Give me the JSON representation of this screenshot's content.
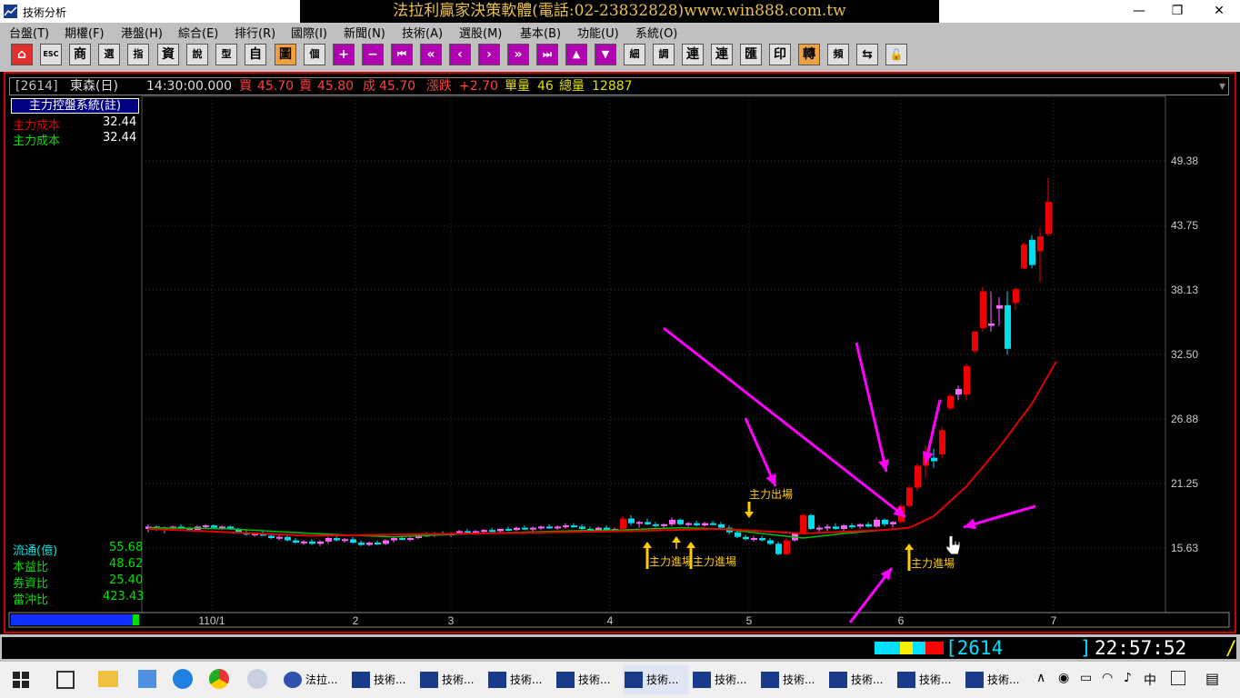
{
  "window": {
    "title": "技術分析",
    "banner": "法拉利贏家決策軟體(電話:02-23832828)www.win888.com.tw"
  },
  "menu": [
    "台盤(T)",
    "期權(F)",
    "港盤(H)",
    "綜合(E)",
    "排行(R)",
    "國際(I)",
    "新聞(N)",
    "技術(A)",
    "選股(M)",
    "基本(B)",
    "功能(U)",
    "系統(O)"
  ],
  "toolbar": [
    "⌂",
    "ESC",
    "商",
    "選",
    "指",
    "資",
    "說",
    "型",
    "自",
    "圖",
    "個",
    "+",
    "−",
    "⏮",
    "«",
    "‹",
    "›",
    "»",
    "⏭",
    "▲",
    "▼",
    "細",
    "調",
    "連",
    "連",
    "匯",
    "印",
    "轉",
    "頻",
    "⇆",
    "🔓"
  ],
  "quote": {
    "code": "[2614]",
    "name": "東森(日)",
    "time": "14:30:00.000",
    "buy_label": "買",
    "buy": "45.70",
    "sell_label": "賣",
    "sell": "45.80",
    "deal_label": "成",
    "deal": "45.70",
    "change_label": "漲跌",
    "change": "+2.70",
    "vol_label": "單量",
    "vol": "46",
    "total_label": "總量",
    "total": "12887"
  },
  "indicator": {
    "system": "主力控盤系統(註)",
    "rows": [
      {
        "label": "主力成本",
        "value": "32.44",
        "color": "#e00000"
      },
      {
        "label": "主力成本",
        "value": "32.44",
        "color": "#00e000"
      }
    ]
  },
  "fundamentals": [
    {
      "label": "流通(億)",
      "value": "55.68"
    },
    {
      "label": "本益比",
      "value": "48.62"
    },
    {
      "label": "券資比",
      "value": "25.40"
    },
    {
      "label": "當沖比",
      "value": "423.43"
    }
  ],
  "chart_data": {
    "type": "candlestick",
    "y_ticks": [
      "49.38",
      "43.75",
      "38.13",
      "32.50",
      "26.88",
      "21.25",
      "15.63"
    ],
    "x_ticks": [
      "110/1",
      "2",
      "3",
      "4",
      "5",
      "6",
      "7"
    ],
    "grid": true,
    "colors": {
      "up": "#ee0000",
      "down": "#00ddee",
      "small_up": "#ff66ff",
      "cost_line_red": "#e00000",
      "cost_line_green": "#00c000",
      "annotation": "#ffcc00",
      "arrows": "#ff00ff"
    },
    "candles": [
      [
        17.3,
        17.7,
        17.0,
        17.5
      ],
      [
        17.5,
        17.6,
        17.1,
        17.3
      ],
      [
        17.3,
        17.5,
        16.9,
        17.4
      ],
      [
        17.4,
        17.6,
        17.2,
        17.5
      ],
      [
        17.5,
        17.7,
        17.3,
        17.4
      ],
      [
        17.4,
        17.5,
        17.1,
        17.2
      ],
      [
        17.2,
        17.6,
        17.1,
        17.5
      ],
      [
        17.5,
        17.7,
        17.3,
        17.6
      ],
      [
        17.6,
        17.7,
        17.3,
        17.4
      ],
      [
        17.4,
        17.6,
        17.2,
        17.5
      ],
      [
        17.5,
        17.6,
        17.2,
        17.3
      ],
      [
        17.3,
        17.4,
        16.9,
        17.0
      ],
      [
        17.0,
        17.2,
        16.7,
        16.8
      ],
      [
        16.8,
        17.0,
        16.6,
        16.9
      ],
      [
        16.9,
        17.1,
        16.7,
        16.7
      ],
      [
        16.7,
        16.9,
        16.4,
        16.5
      ],
      [
        16.5,
        16.8,
        16.3,
        16.6
      ],
      [
        16.6,
        16.8,
        16.2,
        16.3
      ],
      [
        16.3,
        16.5,
        16.0,
        16.1
      ],
      [
        16.1,
        16.3,
        15.9,
        16.2
      ],
      [
        16.2,
        16.4,
        15.9,
        16.0
      ],
      [
        16.0,
        16.3,
        15.8,
        16.2
      ],
      [
        16.2,
        16.6,
        16.0,
        16.5
      ],
      [
        16.5,
        16.7,
        16.2,
        16.3
      ],
      [
        16.3,
        16.5,
        16.1,
        16.4
      ],
      [
        16.4,
        16.6,
        16.0,
        16.1
      ],
      [
        16.1,
        16.3,
        15.8,
        15.9
      ],
      [
        15.9,
        16.2,
        15.8,
        16.1
      ],
      [
        16.1,
        16.3,
        15.9,
        16.0
      ],
      [
        16.0,
        16.4,
        15.9,
        16.3
      ],
      [
        16.3,
        16.6,
        16.1,
        16.5
      ],
      [
        16.5,
        16.7,
        16.3,
        16.4
      ],
      [
        16.4,
        16.6,
        16.2,
        16.5
      ],
      [
        16.5,
        16.9,
        16.4,
        16.8
      ],
      [
        16.8,
        17.0,
        16.6,
        16.7
      ],
      [
        16.7,
        17.0,
        16.6,
        16.9
      ],
      [
        16.9,
        17.1,
        16.7,
        16.8
      ],
      [
        16.8,
        17.0,
        16.6,
        16.9
      ],
      [
        16.9,
        17.2,
        16.8,
        17.1
      ],
      [
        17.1,
        17.3,
        16.9,
        17.0
      ],
      [
        17.0,
        17.2,
        16.8,
        17.1
      ],
      [
        17.1,
        17.3,
        16.9,
        17.2
      ],
      [
        17.2,
        17.4,
        17.0,
        17.1
      ],
      [
        17.1,
        17.3,
        16.9,
        17.3
      ],
      [
        17.3,
        17.5,
        17.1,
        17.2
      ],
      [
        17.2,
        17.5,
        17.1,
        17.4
      ],
      [
        17.4,
        17.6,
        17.2,
        17.3
      ],
      [
        17.3,
        17.5,
        17.1,
        17.4
      ],
      [
        17.4,
        17.6,
        17.2,
        17.5
      ],
      [
        17.5,
        17.7,
        17.3,
        17.4
      ],
      [
        17.4,
        17.6,
        17.2,
        17.5
      ],
      [
        17.5,
        17.8,
        17.3,
        17.6
      ],
      [
        17.6,
        17.8,
        17.4,
        17.5
      ],
      [
        17.5,
        17.7,
        17.2,
        17.3
      ],
      [
        17.3,
        17.5,
        17.0,
        17.2
      ],
      [
        17.2,
        17.5,
        17.0,
        17.4
      ],
      [
        17.4,
        17.6,
        17.1,
        17.2
      ],
      [
        17.2,
        17.4,
        17.0,
        17.3
      ],
      [
        17.3,
        18.4,
        17.2,
        18.2
      ],
      [
        18.2,
        18.5,
        17.6,
        17.8
      ],
      [
        17.8,
        18.0,
        17.4,
        17.9
      ],
      [
        17.9,
        18.2,
        17.6,
        17.7
      ],
      [
        17.7,
        17.9,
        17.4,
        17.6
      ],
      [
        17.6,
        17.8,
        17.3,
        17.7
      ],
      [
        17.7,
        18.3,
        17.5,
        18.1
      ],
      [
        18.1,
        18.2,
        17.6,
        17.7
      ],
      [
        17.7,
        17.9,
        17.5,
        17.8
      ],
      [
        17.8,
        18.0,
        17.5,
        17.6
      ],
      [
        17.6,
        17.9,
        17.5,
        17.8
      ],
      [
        17.8,
        18.0,
        17.6,
        17.7
      ],
      [
        17.7,
        17.9,
        17.2,
        17.4
      ],
      [
        17.4,
        17.6,
        16.8,
        17.0
      ],
      [
        17.0,
        17.2,
        16.5,
        16.6
      ],
      [
        16.6,
        16.8,
        16.3,
        16.4
      ],
      [
        16.4,
        16.7,
        16.2,
        16.5
      ],
      [
        16.5,
        16.7,
        16.2,
        16.3
      ],
      [
        16.3,
        16.5,
        15.9,
        16.0
      ],
      [
        16.0,
        16.2,
        15.0,
        15.1
      ],
      [
        15.1,
        16.5,
        15.0,
        16.3
      ],
      [
        16.3,
        17.0,
        16.2,
        16.9
      ],
      [
        16.9,
        18.6,
        16.8,
        18.5
      ],
      [
        18.5,
        18.6,
        17.2,
        17.3
      ],
      [
        17.3,
        17.6,
        17.0,
        17.4
      ],
      [
        17.4,
        17.7,
        17.1,
        17.5
      ],
      [
        17.5,
        17.8,
        17.2,
        17.3
      ],
      [
        17.3,
        17.7,
        17.1,
        17.6
      ],
      [
        17.6,
        17.8,
        17.3,
        17.5
      ],
      [
        17.5,
        17.8,
        17.3,
        17.7
      ],
      [
        17.7,
        17.9,
        17.4,
        17.5
      ],
      [
        17.5,
        18.3,
        17.4,
        18.1
      ],
      [
        18.1,
        18.2,
        17.5,
        17.7
      ],
      [
        17.7,
        18.0,
        17.4,
        17.9
      ],
      [
        17.9,
        19.5,
        17.8,
        19.3
      ],
      [
        19.3,
        21.1,
        19.2,
        20.9
      ],
      [
        20.9,
        23.0,
        20.6,
        22.8
      ],
      [
        22.8,
        24.6,
        21.8,
        24.0
      ],
      [
        23.5,
        24.3,
        22.6,
        23.2
      ],
      [
        23.8,
        26.2,
        23.5,
        25.9
      ],
      [
        27.8,
        29.1,
        27.6,
        28.9
      ],
      [
        29.0,
        29.8,
        28.5,
        29.5
      ],
      [
        29.0,
        31.7,
        28.5,
        31.5
      ],
      [
        32.8,
        34.6,
        32.6,
        34.5
      ],
      [
        34.8,
        38.4,
        34.5,
        38.0
      ],
      [
        35.0,
        38.0,
        34.5,
        35.2
      ],
      [
        36.5,
        37.5,
        35.0,
        36.8
      ],
      [
        36.8,
        38.0,
        32.5,
        33.0
      ],
      [
        37.0,
        38.4,
        36.4,
        38.2
      ],
      [
        40.0,
        42.3,
        39.9,
        42.1
      ],
      [
        42.5,
        42.9,
        40.0,
        40.3
      ],
      [
        41.5,
        43.5,
        38.8,
        42.8
      ],
      [
        43.0,
        47.9,
        42.8,
        45.8
      ]
    ],
    "cost_line_green": [
      [
        0,
        17.4
      ],
      [
        10,
        17.3
      ],
      [
        20,
        16.9
      ],
      [
        30,
        16.6
      ],
      [
        40,
        16.9
      ],
      [
        50,
        17.1
      ],
      [
        58,
        17.2
      ],
      [
        65,
        17.4
      ],
      [
        70,
        17.3
      ],
      [
        75,
        16.9
      ],
      [
        80,
        16.5
      ],
      [
        85,
        16.9
      ],
      [
        90,
        17.2
      ]
    ],
    "cost_line_red": [
      [
        0,
        17.3
      ],
      [
        20,
        16.7
      ],
      [
        40,
        16.9
      ],
      [
        58,
        17.1
      ],
      [
        70,
        17.3
      ],
      [
        80,
        16.9
      ],
      [
        90,
        17.2
      ],
      [
        93,
        17.4
      ],
      [
        96,
        18.4
      ],
      [
        100,
        21.0
      ],
      [
        104,
        24.4
      ],
      [
        108,
        28.2
      ],
      [
        111,
        31.9
      ]
    ],
    "annotations": [
      {
        "label": "主力進場",
        "type": "up"
      },
      {
        "label": "",
        "type": "up-small"
      },
      {
        "label": "主力進場",
        "type": "up"
      },
      {
        "label": "主力出場",
        "type": "down"
      },
      {
        "label": "主力進場",
        "type": "up"
      }
    ]
  },
  "status": {
    "code": "[2614",
    "bracket_end": "]",
    "time": "22:57:52",
    "slash": "/"
  },
  "taskbar": {
    "tasks": [
      "法拉...",
      "技術...",
      "技術...",
      "技術...",
      "技術...",
      "技術...",
      "技術...",
      "技術...",
      "技術...",
      "技術...",
      "技術..."
    ],
    "tray_lang": "中"
  }
}
